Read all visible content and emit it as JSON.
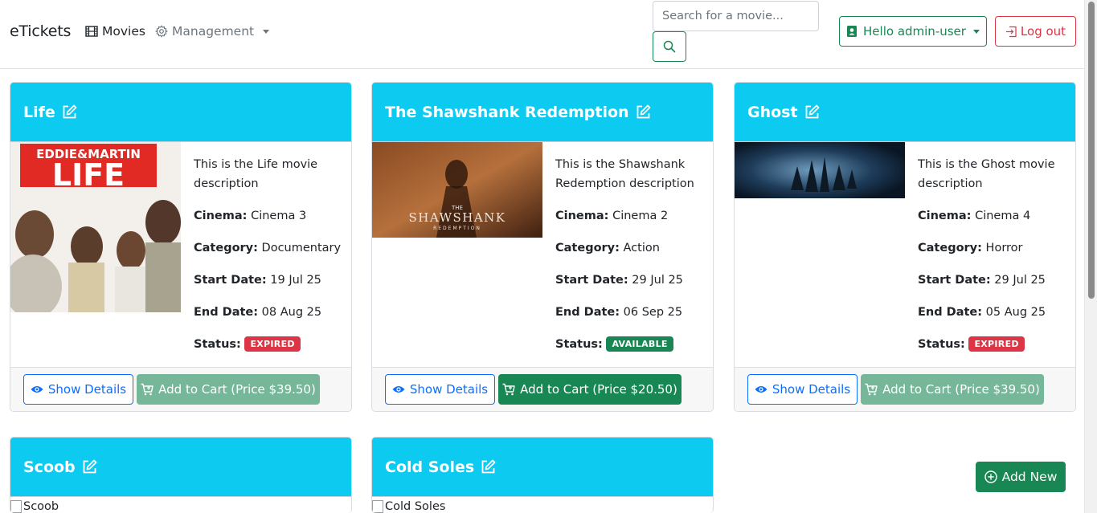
{
  "navbar": {
    "brand": "eTickets",
    "movies_label": "Movies",
    "management_label": "Management",
    "search_placeholder": "Search for a movie...",
    "user_label": "Hello admin-user",
    "logout_label": "Log out"
  },
  "cards": [
    {
      "title": "Life",
      "description": "This is the Life movie description",
      "cinema": "Cinema 3",
      "category": "Documentary",
      "start_date": "19 Jul 25",
      "end_date": "08 Aug 25",
      "status": "EXPIRED",
      "details_label": "Show Details",
      "cart_label": "Add to Cart (Price $39.50)",
      "poster_text_top": "EDDIE&MARTIN",
      "poster_text_main": "LIFE"
    },
    {
      "title": "The Shawshank Redemption",
      "description": "This is the Shawshank Redemption description",
      "cinema": "Cinema 2",
      "category": "Action",
      "start_date": "29 Jul 25",
      "end_date": "06 Sep 25",
      "status": "AVAILABLE",
      "details_label": "Show Details",
      "cart_label": "Add to Cart (Price $20.50)",
      "poster_text_top": "THE",
      "poster_text_main": "SHAWSHANK",
      "poster_text_sub": "REDEMPTION"
    },
    {
      "title": "Ghost",
      "description": "This is the Ghost movie description",
      "cinema": "Cinema 4",
      "category": "Horror",
      "start_date": "29 Jul 25",
      "end_date": "05 Aug 25",
      "status": "EXPIRED",
      "details_label": "Show Details",
      "cart_label": "Add to Cart (Price $39.50)"
    },
    {
      "title": "Scoob",
      "poster_alt": "Scoob"
    },
    {
      "title": "Cold Soles",
      "poster_alt": "Cold Soles"
    }
  ],
  "labels": {
    "cinema": "Cinema:",
    "category": "Category:",
    "start_date": "Start Date:",
    "end_date": "End Date:",
    "status": "Status:"
  },
  "add_new_label": "Add New",
  "colors": {
    "header": "#0dcaf0",
    "success": "#198754",
    "danger": "#dc3545",
    "primary": "#0d6efd"
  }
}
